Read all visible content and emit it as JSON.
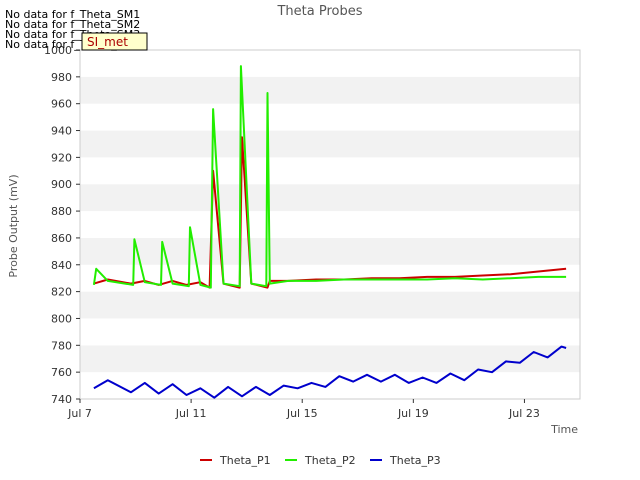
{
  "chart_data": {
    "type": "line",
    "title": "Theta Probes",
    "xlabel": "Time",
    "ylabel": "Probe Output (mV)",
    "ylim": [
      740,
      1000
    ],
    "y_ticks": [
      740,
      760,
      780,
      800,
      820,
      840,
      860,
      880,
      900,
      920,
      940,
      960,
      980,
      1000
    ],
    "xlim": [
      "2025-07-07",
      "2025-07-25"
    ],
    "x_ticks": [
      {
        "date": "2025-07-07",
        "label": "Jul 7"
      },
      {
        "date": "2025-07-11",
        "label": "Jul 11"
      },
      {
        "date": "2025-07-15",
        "label": "Jul 15"
      },
      {
        "date": "2025-07-19",
        "label": "Jul 19"
      },
      {
        "date": "2025-07-23",
        "label": "Jul 23"
      }
    ],
    "grid": "horizontal bands",
    "legend_position": "bottom",
    "no_data_messages": [
      "No data for f_Theta_SM1",
      "No data for f_Theta_SM2",
      "No data for f_Theta_SM3",
      "No data for f_Theta_SM4"
    ],
    "badge": "SI_met",
    "series": [
      {
        "name": "Theta_P1",
        "color": "#cc0000",
        "x": [
          "2025-07-07T12:00",
          "2025-07-08T00:00",
          "2025-07-08T20:00",
          "2025-07-09T08:00",
          "2025-07-09T20:00",
          "2025-07-10T08:00",
          "2025-07-10T20:00",
          "2025-07-11T08:00",
          "2025-07-11T16:00",
          "2025-07-11T19:00",
          "2025-07-12T04:00",
          "2025-07-12T18:00",
          "2025-07-12T20:00",
          "2025-07-13T04:00",
          "2025-07-13T18:00",
          "2025-07-13T20:00",
          "2025-07-14T12:00",
          "2025-07-15T12:00",
          "2025-07-16T12:00",
          "2025-07-17T12:00",
          "2025-07-18T12:00",
          "2025-07-19T12:00",
          "2025-07-20T12:00",
          "2025-07-21T12:00",
          "2025-07-22T12:00",
          "2025-07-23T12:00",
          "2025-07-24T12:00"
        ],
        "values": [
          826,
          829,
          826,
          828,
          825,
          828,
          825,
          827,
          823,
          910,
          826,
          823,
          935,
          826,
          823,
          828,
          828,
          829,
          829,
          830,
          830,
          831,
          831,
          832,
          833,
          835,
          837
        ]
      },
      {
        "name": "Theta_P2",
        "color": "#22ee00",
        "x": [
          "2025-07-07T12:00",
          "2025-07-07T14:00",
          "2025-07-08T00:00",
          "2025-07-08T22:00",
          "2025-07-08T23:00",
          "2025-07-09T08:00",
          "2025-07-09T22:00",
          "2025-07-09T23:00",
          "2025-07-10T08:00",
          "2025-07-10T22:00",
          "2025-07-10T23:00",
          "2025-07-11T08:00",
          "2025-07-11T17:00",
          "2025-07-11T19:00",
          "2025-07-12T04:00",
          "2025-07-12T18:00",
          "2025-07-12T19:00",
          "2025-07-13T04:00",
          "2025-07-13T17:00",
          "2025-07-13T18:00",
          "2025-07-13T20:00",
          "2025-07-14T12:00",
          "2025-07-15T12:00",
          "2025-07-16T12:00",
          "2025-07-17T12:00",
          "2025-07-18T12:00",
          "2025-07-19T12:00",
          "2025-07-20T12:00",
          "2025-07-21T12:00",
          "2025-07-22T12:00",
          "2025-07-23T12:00",
          "2025-07-24T12:00"
        ],
        "values": [
          825,
          837,
          828,
          825,
          859,
          827,
          825,
          857,
          826,
          824,
          868,
          825,
          823,
          956,
          826,
          824,
          988,
          826,
          824,
          968,
          826,
          828,
          828,
          829,
          829,
          829,
          829,
          830,
          829,
          830,
          831,
          831
        ]
      },
      {
        "name": "Theta_P3",
        "color": "#0000cc",
        "x": [
          "2025-07-07T12:00",
          "2025-07-08T00:00",
          "2025-07-08T20:00",
          "2025-07-09T08:00",
          "2025-07-09T20:00",
          "2025-07-10T08:00",
          "2025-07-10T20:00",
          "2025-07-11T08:00",
          "2025-07-11T20:00",
          "2025-07-12T08:00",
          "2025-07-12T20:00",
          "2025-07-13T08:00",
          "2025-07-13T20:00",
          "2025-07-14T08:00",
          "2025-07-14T20:00",
          "2025-07-15T08:00",
          "2025-07-15T20:00",
          "2025-07-16T08:00",
          "2025-07-16T20:00",
          "2025-07-17T08:00",
          "2025-07-17T20:00",
          "2025-07-18T08:00",
          "2025-07-18T20:00",
          "2025-07-19T08:00",
          "2025-07-19T20:00",
          "2025-07-20T08:00",
          "2025-07-20T20:00",
          "2025-07-21T08:00",
          "2025-07-21T20:00",
          "2025-07-22T08:00",
          "2025-07-22T20:00",
          "2025-07-23T08:00",
          "2025-07-23T20:00",
          "2025-07-24T08:00",
          "2025-07-24T12:00"
        ],
        "values": [
          748,
          754,
          745,
          752,
          744,
          751,
          743,
          748,
          741,
          749,
          742,
          749,
          743,
          750,
          748,
          752,
          749,
          757,
          753,
          758,
          753,
          758,
          752,
          756,
          752,
          759,
          754,
          762,
          760,
          768,
          767,
          775,
          771,
          779,
          778
        ]
      }
    ]
  }
}
